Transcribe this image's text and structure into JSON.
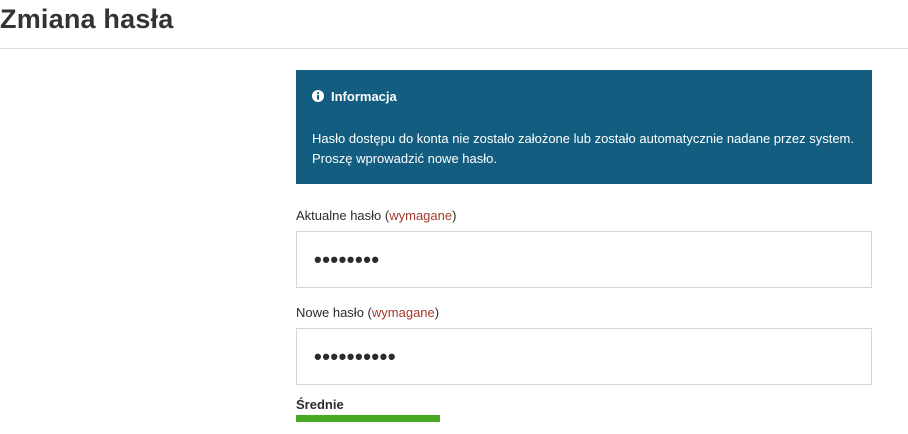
{
  "page": {
    "title": "Zmiana hasła"
  },
  "info": {
    "icon": "info-circle-icon",
    "heading": "Informacja",
    "message": "Hasło dostępu do konta nie zostało założone lub zostało automatycznie nadane przez system. Proszę wprowadzić nowe hasło.",
    "background_color": "#135e80"
  },
  "form": {
    "current_password": {
      "label": "Aktualne hasło",
      "required_text": "wymagane",
      "value": "••••••••"
    },
    "new_password": {
      "label": "Nowe hasło",
      "required_text": "wymagane",
      "value": "••••••••••"
    },
    "strength": {
      "label": "Średnie",
      "level": 0.5,
      "color": "#48a822"
    }
  }
}
